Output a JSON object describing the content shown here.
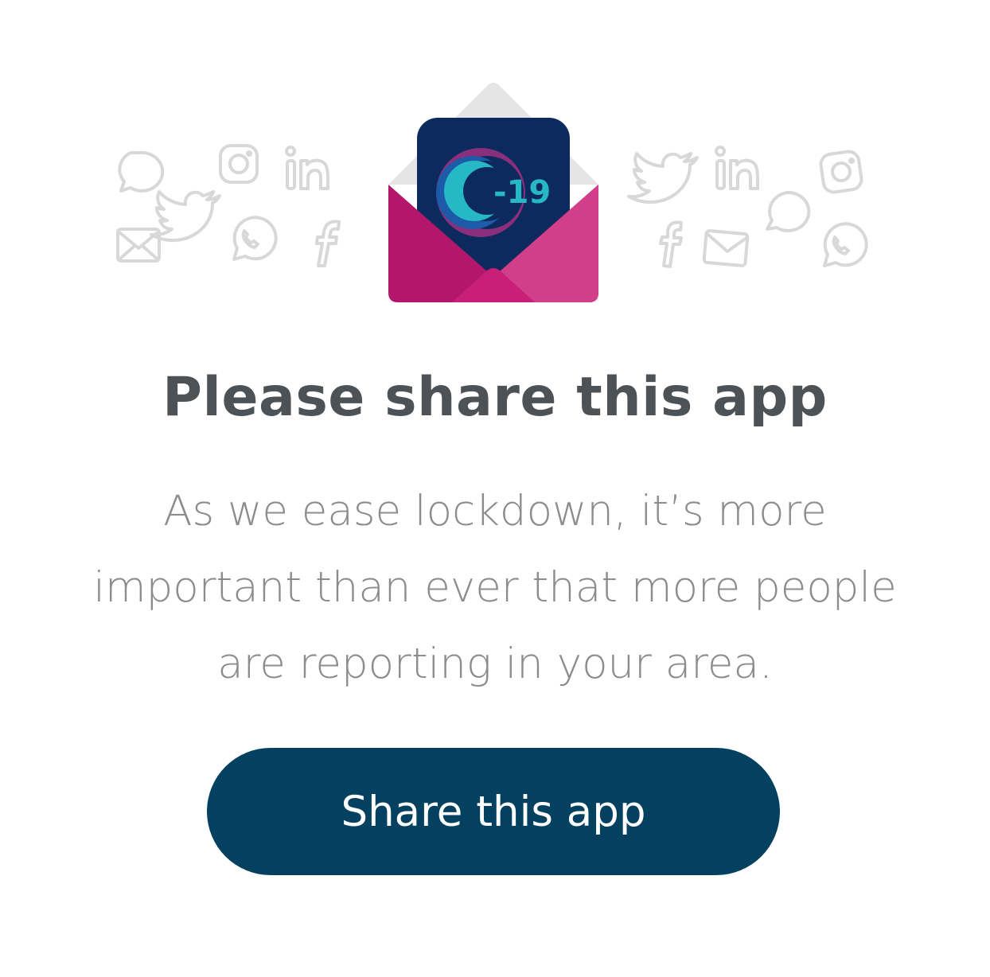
{
  "app_icon": {
    "logo_text": "-19",
    "colors": {
      "icon_bg": "#0c2a5e",
      "envelope": "#b3176b",
      "envelope_light": "#d13e8a",
      "crescent_teal": "#26b8c4",
      "crescent_purple": "#8a2f7c"
    }
  },
  "social_icons_left": [
    "speech-bubble-icon",
    "instagram-icon",
    "linkedin-icon",
    "twitter-icon",
    "email-icon",
    "whatsapp-icon",
    "facebook-icon"
  ],
  "social_icons_right": [
    "twitter-icon",
    "linkedin-icon",
    "instagram-icon",
    "speech-bubble-icon",
    "facebook-icon",
    "email-icon",
    "whatsapp-icon"
  ],
  "title": "Please share this app",
  "body_lines": [
    "As we ease lockdown, it’s more",
    "important than ever that more people",
    "are reporting in your area."
  ],
  "share_button": {
    "label": "Share this app",
    "color": "#04405f"
  }
}
